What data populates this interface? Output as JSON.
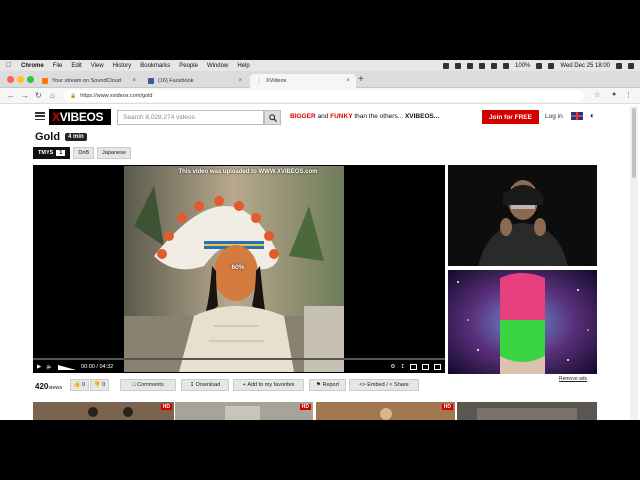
{
  "menubar": {
    "app": "Chrome",
    "items": [
      "File",
      "Edit",
      "View",
      "History",
      "Bookmarks",
      "People",
      "Window",
      "Help"
    ],
    "battery": "100%",
    "clock": "Wed Dec 25  18:00"
  },
  "tabs": [
    {
      "title": "Your stream on SoundCloud",
      "favicon_color": "#ff7700"
    },
    {
      "title": "(16) Facebook",
      "favicon_color": "#3b5998"
    },
    {
      "title": "XVideos",
      "favicon_color": "#d40000"
    }
  ],
  "address_bar": {
    "url": "https://www.xvideos.com/gold"
  },
  "site": {
    "logo_x": "X",
    "logo_text": "VIBEOS",
    "search_placeholder": "Search 8,028,274 videos",
    "tagline_1": "BIGGER",
    "tagline_and": "and",
    "tagline_2": "FUNKY",
    "tagline_rest": "than the others...",
    "tagline_brand": "XVIBEOS...",
    "join_label": "Join for FREE",
    "login_label": "Log in"
  },
  "video": {
    "title": "Gold",
    "duration": "4 min",
    "uploader": "TMYS",
    "uploader_count": "1",
    "tags": [
      "DnB",
      "Japanese"
    ],
    "watermark": "This video was uploaded to WWW.XVIBEOS.com",
    "buffer_label": "60%",
    "time": "00:00 / 04:32",
    "progress": 0
  },
  "actions": {
    "views_count": "420",
    "views_label": "views",
    "likes": "0",
    "dislikes": "0",
    "comments": "Comments",
    "download": "Download",
    "add_favorites": "Add to my favorites",
    "report": "Report",
    "embed": "Embed",
    "share": "Share"
  },
  "sidebar": {
    "remove_ads": "Remove ads"
  },
  "thumbnails": [
    {
      "badge": "HD"
    },
    {
      "badge": "HD"
    },
    {
      "badge": "HD"
    }
  ],
  "colors": {
    "brand_red": "#d40000",
    "brand_black": "#000000"
  }
}
